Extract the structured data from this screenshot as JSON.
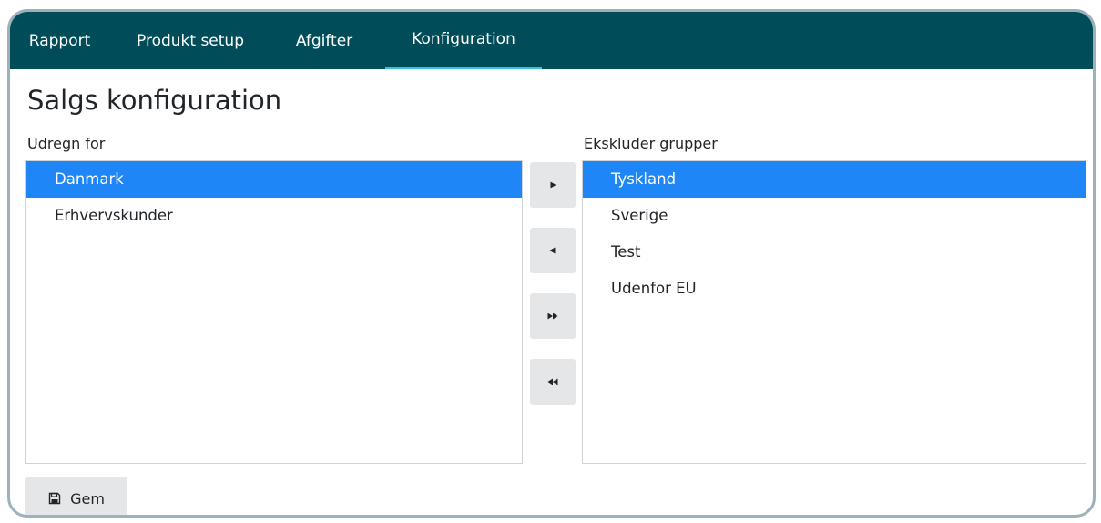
{
  "nav": {
    "tabs": [
      {
        "label": "Rapport"
      },
      {
        "label": "Produkt setup"
      },
      {
        "label": "Afgifter"
      },
      {
        "label": "Konfiguration"
      }
    ]
  },
  "page": {
    "title": "Salgs konfiguration"
  },
  "left": {
    "label": "Udregn for",
    "items": [
      {
        "label": "Danmark",
        "selected": true
      },
      {
        "label": "Erhvervskunder",
        "selected": false
      }
    ]
  },
  "right": {
    "label": "Ekskluder grupper",
    "items": [
      {
        "label": "Tyskland",
        "selected": true
      },
      {
        "label": "Sverige",
        "selected": false
      },
      {
        "label": "Test",
        "selected": false
      },
      {
        "label": "Udenfor EU",
        "selected": false
      }
    ]
  },
  "transfer": {
    "buttons": [
      {
        "icon": "move-right-icon"
      },
      {
        "icon": "move-left-icon"
      },
      {
        "icon": "move-all-right-icon"
      },
      {
        "icon": "move-all-left-icon"
      }
    ]
  },
  "actions": {
    "save_label": "Gem",
    "save_icon": "save-icon"
  },
  "colors": {
    "navbar": "#004d59",
    "active_tab_underline": "#35c2e0",
    "selected_item": "#1e86f6",
    "button_bg": "#e4e6e8"
  }
}
